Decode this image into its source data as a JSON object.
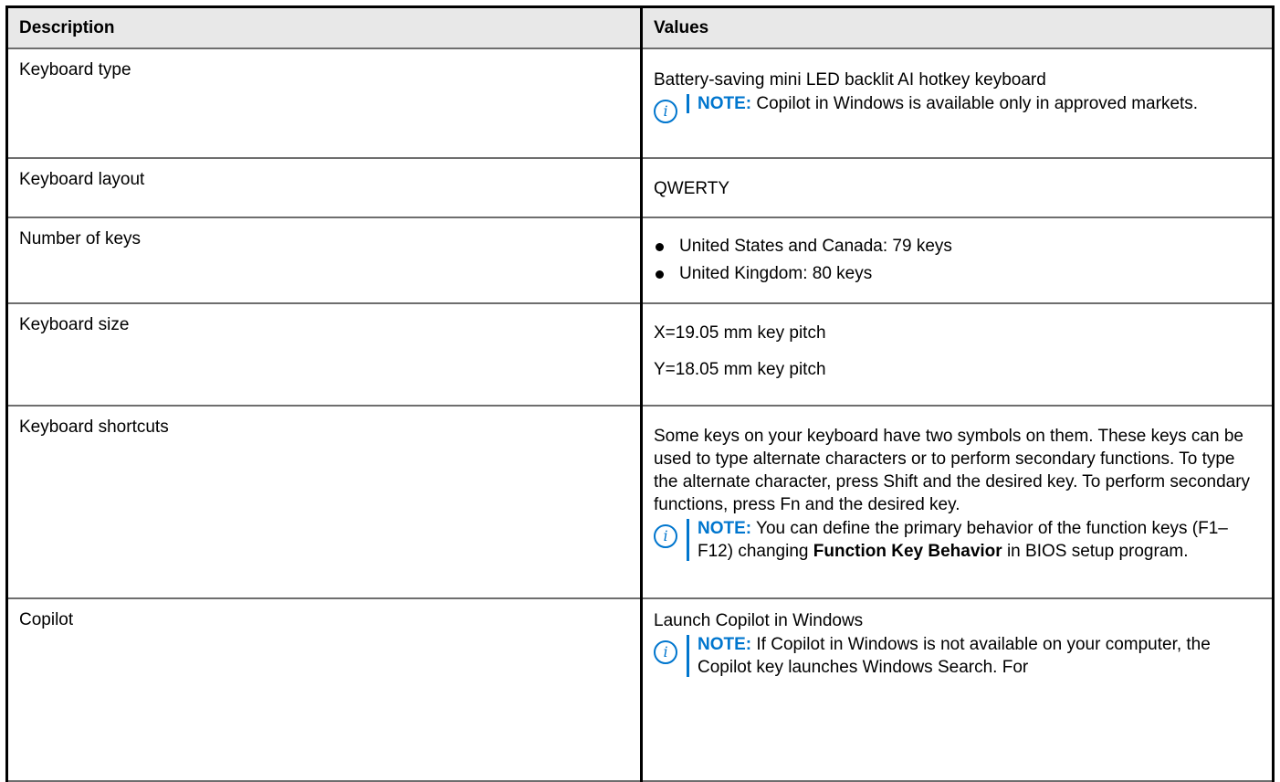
{
  "table": {
    "headers": {
      "description": "Description",
      "values": "Values"
    },
    "note_label": "NOTE:",
    "rows": {
      "keyboard_type": {
        "label": "Keyboard type",
        "value": "Battery-saving mini LED backlit AI hotkey keyboard",
        "note": "Copilot in Windows is available only in approved markets."
      },
      "keyboard_layout": {
        "label": "Keyboard layout",
        "value": "QWERTY"
      },
      "number_of_keys": {
        "label": "Number of keys",
        "items": [
          "United States and Canada: 79 keys",
          "United Kingdom: 80 keys"
        ]
      },
      "keyboard_size": {
        "label": "Keyboard size",
        "x": "X=19.05 mm key pitch",
        "y": "Y=18.05 mm key pitch"
      },
      "keyboard_shortcuts": {
        "label": "Keyboard shortcuts",
        "value": "Some keys on your keyboard have two symbols on them. These keys can be used to type alternate characters or to perform secondary functions. To type the alternate character, press Shift and the desired key. To perform secondary functions, press Fn and the desired key.",
        "note_pre": "You can define the primary behavior of the function keys (F1–F12) changing",
        "note_bold": "Function Key Behavior",
        "note_post": "in BIOS setup program."
      },
      "copilot": {
        "label": "Copilot",
        "value": "Launch Copilot in Windows",
        "note": "If Copilot in Windows is not available on your computer, the Copilot key launches Windows Search. For"
      }
    }
  },
  "icons": {
    "note": "info-icon",
    "note_glyph": "i"
  },
  "colors": {
    "accent": "#0076ce",
    "header_bg": "#e8e8e8"
  }
}
